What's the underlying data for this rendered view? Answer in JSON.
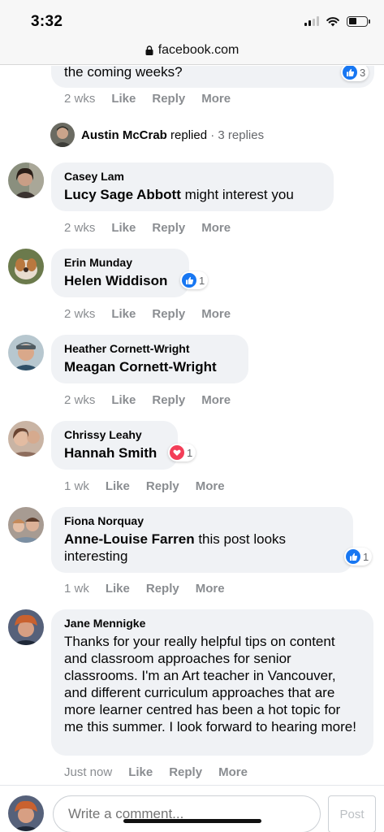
{
  "status": {
    "time": "3:32"
  },
  "browser": {
    "url": "facebook.com"
  },
  "top_comment": {
    "text_tail": "the coming weeks?",
    "time": "2 wks",
    "like": "Like",
    "reply": "Reply",
    "more": "More",
    "reaction_count": "3"
  },
  "replied": {
    "name": "Austin McCrab",
    "verb": "replied",
    "sep": "·",
    "count": "3 replies"
  },
  "comments": [
    {
      "author": "Casey Lam",
      "mention": "Lucy Sage Abbott",
      "text": " might interest you",
      "time": "2 wks",
      "like": "Like",
      "reply": "Reply",
      "more": "More"
    },
    {
      "author": "Erin Munday",
      "mention": "Helen Widdison",
      "text": "",
      "reaction_count": "1",
      "time": "2 wks",
      "like": "Like",
      "reply": "Reply",
      "more": "More"
    },
    {
      "author": "Heather Cornett-Wright",
      "mention": "Meagan Cornett-Wright",
      "text": "",
      "time": "2 wks",
      "like": "Like",
      "reply": "Reply",
      "more": "More"
    },
    {
      "author": "Chrissy Leahy",
      "mention": "Hannah Smith",
      "text": "",
      "reaction_count": "1",
      "time": "1 wk",
      "like": "Like",
      "reply": "Reply",
      "more": "More"
    },
    {
      "author": "Fiona Norquay",
      "mention": "Anne-Louise Farren",
      "text": " this post looks interesting",
      "reaction_count": "1",
      "time": "1 wk",
      "like": "Like",
      "reply": "Reply",
      "more": "More"
    },
    {
      "author": "Jane Mennigke",
      "mention": "",
      "text": "Thanks for your really helpful tips on content and classroom approaches for senior classrooms. I'm an Art teacher in Vancouver, and different curriculum approaches that are more learner centred has been a hot topic for me this summer. I look forward to hearing more!",
      "time": "Just now",
      "like": "Like",
      "reply": "Reply",
      "more": "More"
    }
  ],
  "composer": {
    "placeholder": "Write a comment...",
    "post_label": "Post"
  },
  "colors": {
    "bubble": "#f0f2f5",
    "muted": "#8a8d91",
    "like_blue": "#1877f2",
    "love_red": "#f33e58"
  },
  "icons": [
    "lock-icon",
    "signal-icon",
    "wifi-icon",
    "battery-icon",
    "like-reaction-icon",
    "love-reaction-icon"
  ]
}
